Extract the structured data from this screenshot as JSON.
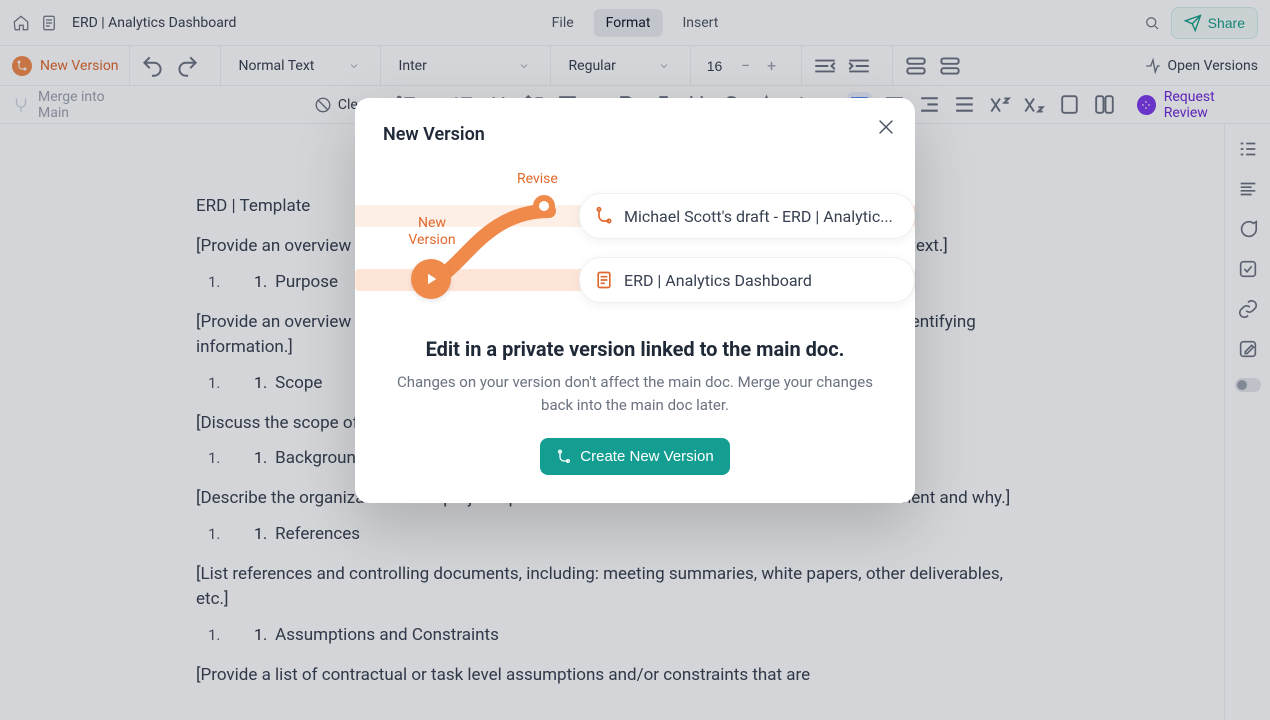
{
  "topbar": {
    "doc_title": "ERD | Analytics Dashboard",
    "menus": {
      "file": "File",
      "format": "Format",
      "insert": "Insert"
    },
    "share": "Share"
  },
  "toolbar": {
    "new_version": "New Version",
    "text_style": "Normal Text",
    "font_family": "Inter",
    "font_weight": "Regular",
    "font_size": "16",
    "open_versions": "Open Versions"
  },
  "thirdbar": {
    "merge": "Merge into Main",
    "clear": "Clear",
    "request_review": "Request Review"
  },
  "outline_numbers": {
    "outer": "1.",
    "inner_prefix": "1."
  },
  "doc": {
    "header": "ERD | Template",
    "sections": [
      {
        "desc": "[Provide an overview of the system and some additional information to place the system in context.]",
        "heading": "Purpose"
      },
      {
        "desc": "[Provide an overview of the system and some additional information to place the system and identifying information.]",
        "heading": "Scope"
      },
      {
        "desc": "[Discuss the scope of the document and how it accomplishes its purpose.]",
        "heading": "Background"
      },
      {
        "desc": "[Describe the organizational and project specific conditions that lead to the need for the document and why.]",
        "heading": "References"
      },
      {
        "desc": "[List references and controlling documents, including: meeting summaries, white papers, other deliverables, etc.]",
        "heading": "Assumptions and Constraints"
      },
      {
        "desc": "[Provide a list of contractual or task level assumptions and/or constraints that are",
        "heading": ""
      }
    ]
  },
  "modal": {
    "title": "New Version",
    "nv_label": "New Version",
    "rv_label": "Revise",
    "draft_card": "Michael Scott's draft - ERD | Analytic...",
    "main_card": "ERD | Analytics Dashboard",
    "headline": "Edit in a private version linked to the main doc.",
    "subtext": "Changes on your version don't affect the main doc. Merge your changes back into the main doc later.",
    "cta": "Create New Version"
  },
  "icons": {
    "home": "home-icon",
    "doc": "doc-icon",
    "search": "search-icon",
    "share": "paper-plane-icon",
    "undo": "undo-icon",
    "redo": "redo-icon"
  }
}
